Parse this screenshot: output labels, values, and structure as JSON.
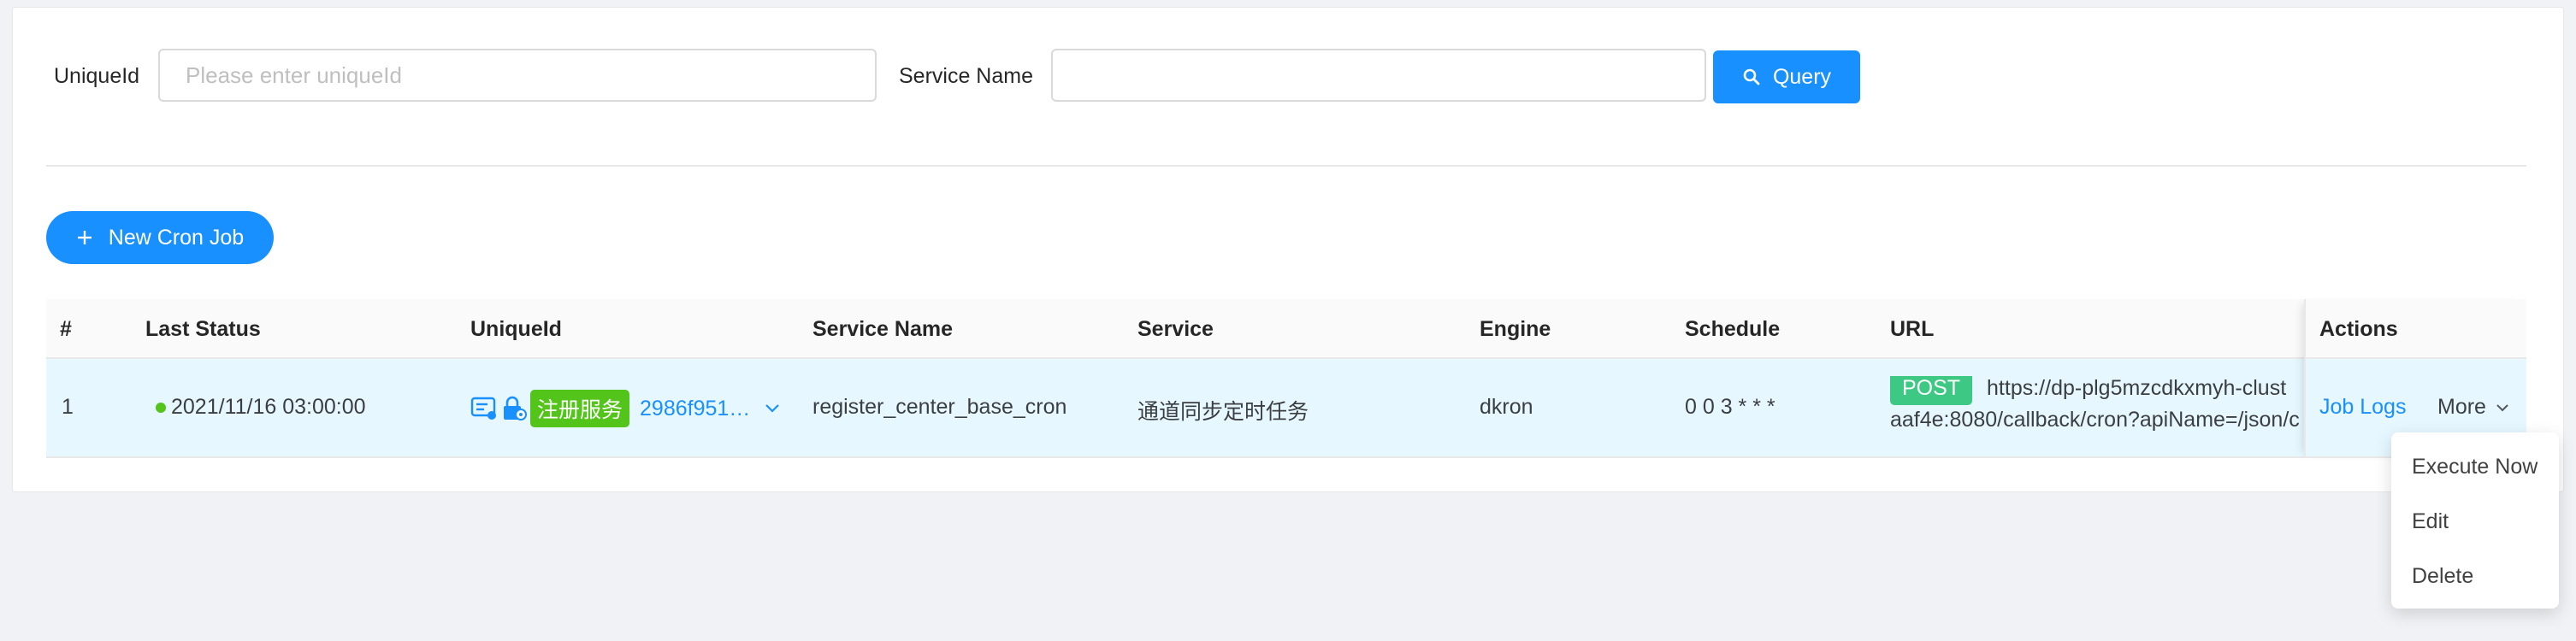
{
  "filters": {
    "unique_id_label": "UniqueId",
    "unique_id_placeholder": "Please enter uniqueId",
    "unique_id_value": "",
    "service_name_label": "Service Name",
    "service_name_value": "",
    "query_label": "Query"
  },
  "new_job_label": "New Cron Job",
  "table": {
    "headers": [
      "#",
      "Last Status",
      "UniqueId",
      "Service Name",
      "Service",
      "Engine",
      "Schedule",
      "URL",
      "Actions"
    ],
    "rows": [
      {
        "index": "1",
        "last_status": "2021/11/16 03:00:00",
        "tag": "注册服务",
        "unique_id": "2986f951…",
        "service_name": "register_center_base_cron",
        "service": "通道同步定时任务",
        "engine": "dkron",
        "schedule": "0 0 3 * * *",
        "method": "POST",
        "url_line1": "https://dp-plg5mzcdkxmyh-clust",
        "url_line2": "aaf4e:8080/callback/cron?apiName=/json/c",
        "job_logs": "Job Logs",
        "more": "More"
      }
    ]
  },
  "more_menu": [
    "Execute Now",
    "Edit",
    "Delete"
  ],
  "colors": {
    "primary": "#1890ff",
    "status_success": "#52c41a",
    "post_tag": "#3dc983",
    "selected_row": "#e6f7ff"
  },
  "icons": [
    "search-icon",
    "plus-icon",
    "chevron-down-icon",
    "service-card-icon",
    "lock-icon"
  ]
}
